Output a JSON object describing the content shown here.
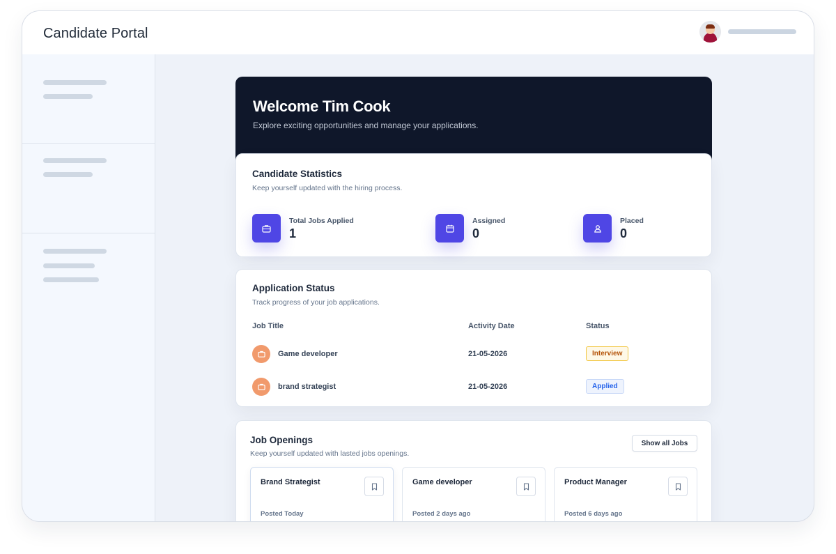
{
  "app": {
    "title": "Candidate Portal"
  },
  "hero": {
    "heading": "Welcome Tim Cook",
    "subtitle": "Explore exciting opportunities and manage your applications."
  },
  "stats": {
    "title": "Candidate Statistics",
    "subtitle": "Keep yourself updated with the hiring process.",
    "items": [
      {
        "label": "Total Jobs Applied",
        "value": "1",
        "icon": "briefcase-icon"
      },
      {
        "label": "Assigned",
        "value": "0",
        "icon": "calendar-icon"
      },
      {
        "label": "Placed",
        "value": "0",
        "icon": "user-icon"
      }
    ]
  },
  "application_status": {
    "title": "Application Status",
    "subtitle": "Track progress of your job applications.",
    "headers": [
      "Job Title",
      "Activity Date",
      "Status"
    ],
    "rows": [
      {
        "job_title": "Game developer",
        "date": "21-05-2026",
        "status": "Interview",
        "status_color": "#b45309"
      },
      {
        "job_title": "brand strategist",
        "date": "21-05-2026",
        "status": "Applied",
        "status_color": "#2563eb"
      }
    ]
  },
  "job_openings": {
    "title": "Job Openings",
    "subtitle": "Keep yourself updated with lasted jobs openings.",
    "show_all_label": "Show all Jobs",
    "jobs": [
      {
        "title": "Brand Strategist",
        "posted": "Posted Today"
      },
      {
        "title": "Game developer",
        "posted": "Posted 2 days ago"
      },
      {
        "title": "Product Manager",
        "posted": "Posted 6 days ago"
      }
    ]
  },
  "colors": {
    "accent": "#4f46e5",
    "hero_bg": "#0f172a",
    "row_icon": "#f19a6c"
  }
}
